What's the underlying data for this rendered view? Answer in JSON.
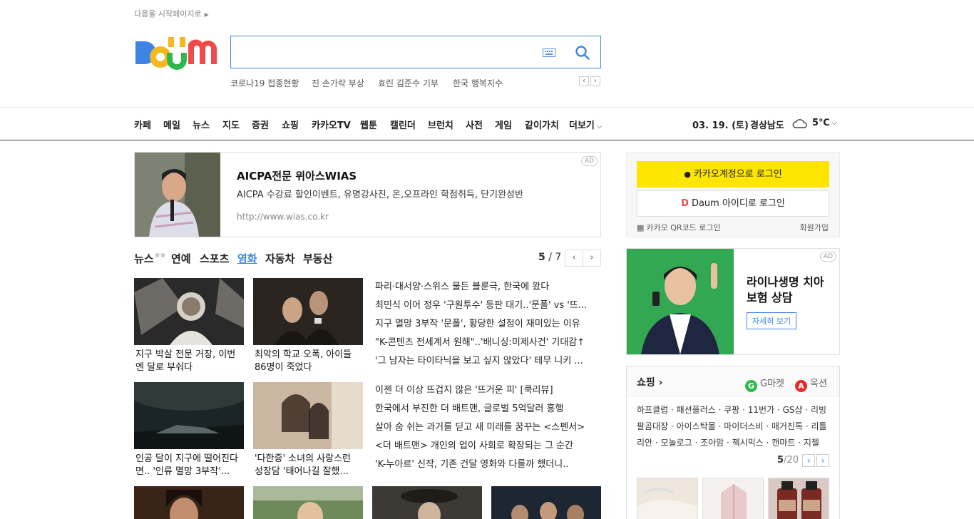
{
  "top": {
    "startpage_label": "다음을 시작페이지로"
  },
  "search": {
    "placeholder": ""
  },
  "trending": [
    "코로나19 접종현황",
    "진 손가락 부상",
    "효린 김준수 기부",
    "한국 행복지수"
  ],
  "gnb": {
    "items": [
      "카페",
      "메일",
      "뉴스",
      "지도",
      "증권",
      "쇼핑",
      "카카오TV",
      "웹툰",
      "캘린더",
      "브런치",
      "사전",
      "게임",
      "같이가치",
      "더보기"
    ],
    "date": "03. 19. (토)",
    "region": "경상남도",
    "temp": "5℃"
  },
  "ad1": {
    "badge": "AD",
    "title": "AICPA전문 위아스WIAS",
    "desc": "AICPA 수강료 할인이벤트, 유명강사진, 온,오프라인 학점취득, 단기완성반",
    "url": "http://www.wias.co.kr"
  },
  "news": {
    "tabs": [
      "뉴스",
      "연예",
      "스포츠",
      "영화",
      "자동차",
      "부동산"
    ],
    "active_tab": "영화",
    "page_current": "5",
    "page_sep": "/",
    "page_total": "7",
    "cards": [
      {
        "caption": "지구 박살 전문 거장, 이번엔 달로 부숴다"
      },
      {
        "caption": "최악의 학교 오폭, 아이들 86명이 죽었다"
      },
      {
        "caption": "인공 달이 지구에 떨어진다면.. '인류 멸망 3부작'..."
      },
      {
        "caption": "'다한증' 소녀의 사랑스런 성장담 '태어나길 잘했..."
      }
    ],
    "headlines_1": [
      "파리·대서양·스위스 물든 블룬극, 한국에 왔다",
      "최민식 이어 정우 '구원투수' 등판 대기..'문폴' vs '뜨...",
      "지구 멸망 3부작 '문폴', 황당한 설정이 재미있는 이유",
      "\"K-콘텐츠 전세계서 원해\"..'배니싱:미제사건' 기대감↑",
      "'그 남자는 타이타닉을 보고 싶지 않았다' 테무 니키 ..."
    ],
    "headlines_2": [
      "이젠 더 이상 뜨겁지 않은 '뜨거운 피' [쿡리뷰]",
      "한국에서 부진한 더 배트맨, 글로벌 5억달러 흥행",
      "살아 숨 쉬는 과거를 딛고 새 미래를 꿈꾸는 <스펜서>",
      "<더 배트맨> 개인의 업이 사회로 확장되는 그 순간",
      "'K-누아르' 신작, 기존 건달 영화와 다를까 했더니.."
    ]
  },
  "login": {
    "kakao": "카카오계정으로 로그인",
    "daum": "Daum 아이디로 로그인",
    "qr": "카카오 QR코드 로그인",
    "signup": "회원가입"
  },
  "ad2": {
    "badge": "AD",
    "title": "라이나생명 치아보험 상담",
    "cta": "자세히 보기"
  },
  "shopping": {
    "title": "쇼핑",
    "gmarket": "G마켓",
    "auction": "옥션",
    "links": "하프클럽 · 패션플러스 · 쿠팡 · 11번가 · GS샵 · 리빙팔곰대장 · 아이스탁몰 · 마이더스비 · 매거진톡 · 리틀리안 · 모놀로그 · 조아맘 · 젝시믹스 · 캔마트 · 지젤",
    "page_current": "5",
    "page_total": "/20"
  },
  "colors": {
    "accent": "#3c84e6",
    "kakao_yellow": "#fee500",
    "ad_green": "#33a853"
  }
}
